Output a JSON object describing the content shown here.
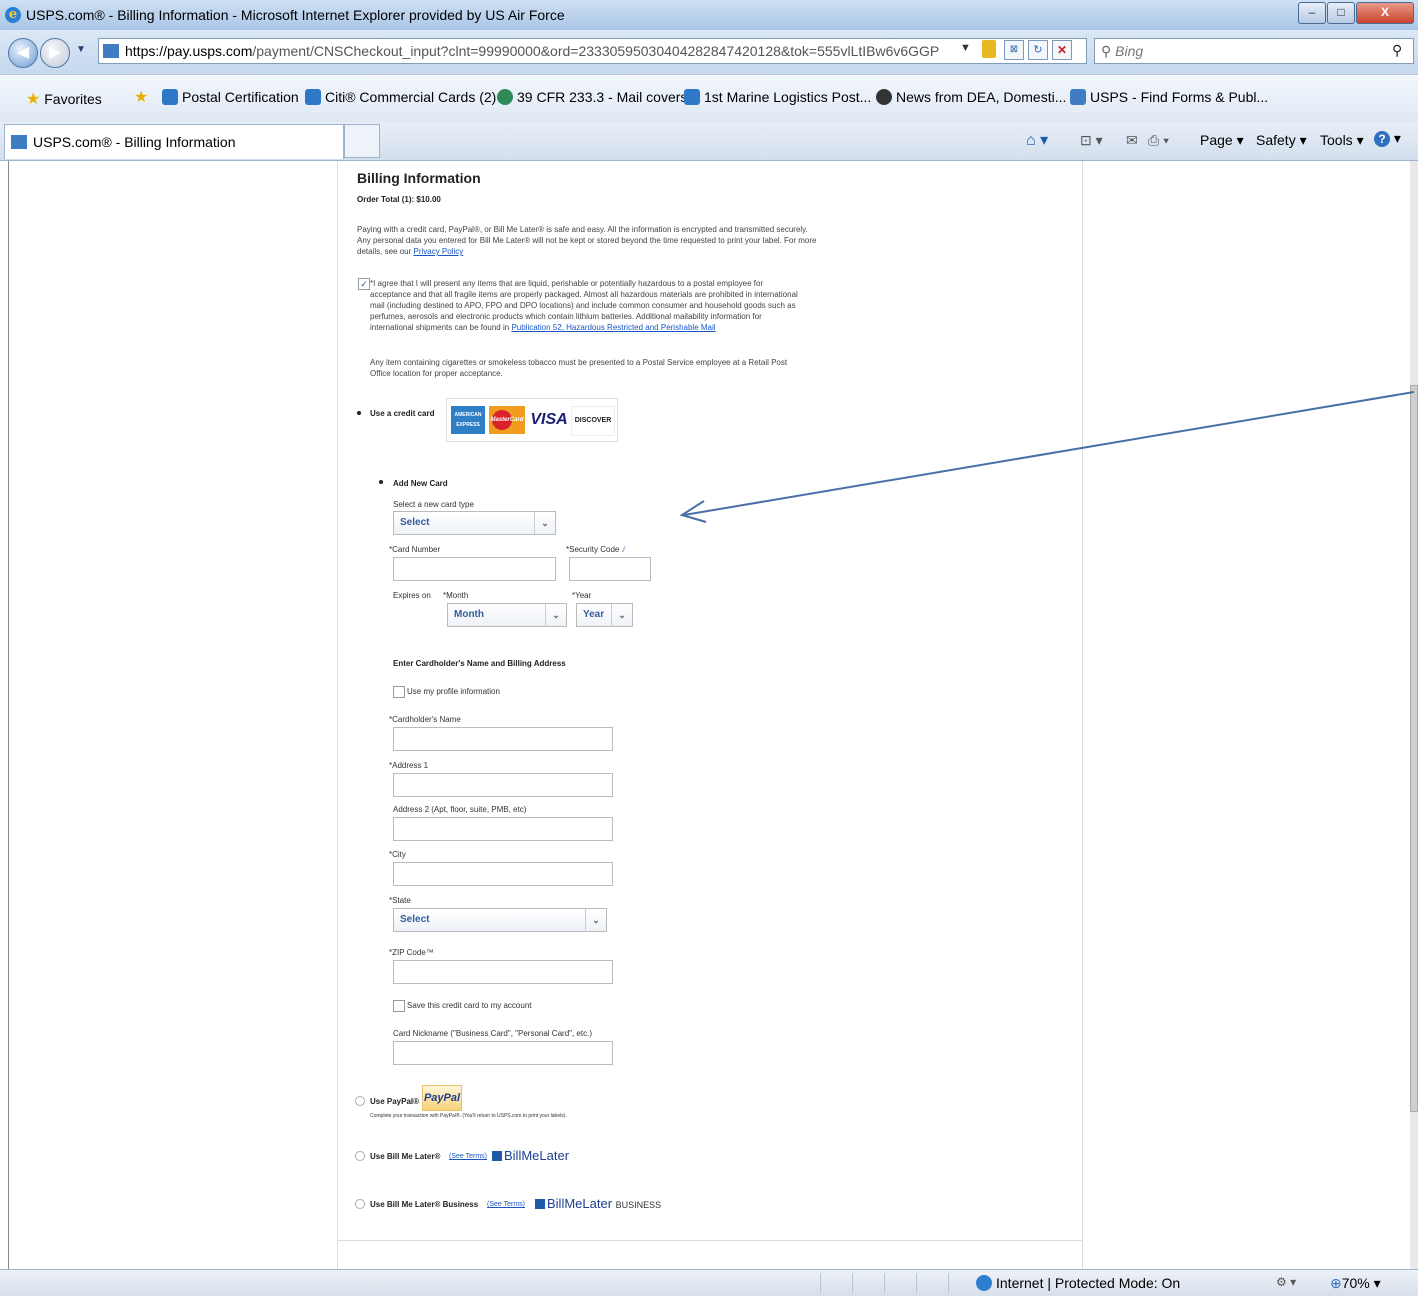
{
  "window": {
    "title": "USPS.com® - Billing Information - Microsoft Internet Explorer provided by US Air Force",
    "controls": [
      "–",
      "□",
      "X"
    ]
  },
  "address_bar": {
    "url_domain": "https://pay.usps.com",
    "url_rest": "/payment/CNSCheckout_input?clnt=99990000&ord=23330595030404282847420128&tok=555vlLtIBw6v6GGP",
    "search_placeholder": "Bing"
  },
  "favorites_bar": {
    "favorites_label": "Favorites",
    "items": [
      "Postal Certification",
      "Citi® Commercial Cards (2)",
      "39 CFR 233.3 - Mail covers",
      "1st Marine Logistics  Post...",
      "News from DEA, Domesti...",
      "USPS - Find Forms & Publ..."
    ]
  },
  "tabs": {
    "active_label": "USPS.com® - Billing Information"
  },
  "command_bar": {
    "page": "Page ▾",
    "safety": "Safety ▾",
    "tools": "Tools ▾"
  },
  "billing": {
    "heading": "Billing Information",
    "order_total": "Order Total (1): $10.00",
    "intro_line1": "Paying with a credit card, PayPal®, or Bill Me Later® is safe and easy. All the information is encrypted and transmitted securely.",
    "intro_line2": "Any personal data you entered for Bill Me Later® will not be kept or stored beyond the time requested to print your label. For more",
    "intro_line3_prefix": "details, see our ",
    "privacy_link": "Privacy Policy",
    "agree_l1": "*I agree that I will present any items that are liquid, perishable or potentially hazardous to a postal employee for",
    "agree_l2": "acceptance and that all fragile items are properly packaged. Almost all hazardous materials are prohibited in international",
    "agree_l3": "mail (including destined to APO, FPO and DPO locations) and include common consumer and household goods such as",
    "agree_l4": "perfumes, aerosols and electronic products which contain lithium batteries. Additional mailability information for",
    "agree_l5_prefix": "international shipments can be found in ",
    "pub52_link": "Publication 52, Hazardous Restricted and Perishable Mail",
    "tobacco_l1": "Any item containing cigarettes or smokeless tobacco must be presented to a Postal Service employee at a Retail Post",
    "tobacco_l2": "Office location for proper acceptance.",
    "use_credit_card": "Use a credit card",
    "card_brands": [
      "AMERICAN EXPRESS",
      "MasterCard",
      "VISA",
      "DISCOVER"
    ],
    "add_new_card": "Add New Card",
    "select_card_type": "Select a new card type",
    "card_type_value": "Select",
    "card_number_label": "*Card Number",
    "security_code_label": "*Security Code",
    "expires_on": "Expires on",
    "month_label": "*Month",
    "month_value": "Month",
    "year_label": "*Year",
    "year_value": "Year",
    "address_heading": "Enter Cardholder's Name and Billing Address",
    "use_profile": "Use my profile information",
    "cardholder_name": "*Cardholder's Name",
    "address1": "*Address 1",
    "address2": "Address 2 (Apt, floor, suite, PMB, etc)",
    "city": "*City",
    "state_label": "*State",
    "state_value": "Select",
    "zip_label": "*ZIP Code™",
    "save_card": "Save this credit card to my account",
    "nickname": "Card Nickname (\"Business Card\", \"Personal Card\", etc.)",
    "use_paypal": "Use PayPal®",
    "paypal_logo": "PayPal",
    "paypal_note": "Complete your transaction with PayPal®. (You'll return to USPS.com to print your labels).",
    "use_bml": "Use Bill Me Later®",
    "see_terms": "(See Terms)",
    "bml_logo": "BillMeLater",
    "use_bml_business": "Use Bill Me Later® Business",
    "bml_business_suffix": "BUSINESS"
  },
  "status_bar": {
    "zone": "Internet | Protected Mode: On",
    "zoom": "70%"
  },
  "colors": {
    "link": "#1a55c4",
    "select_text": "#335d9a",
    "arrow": "#4a6fa8"
  }
}
